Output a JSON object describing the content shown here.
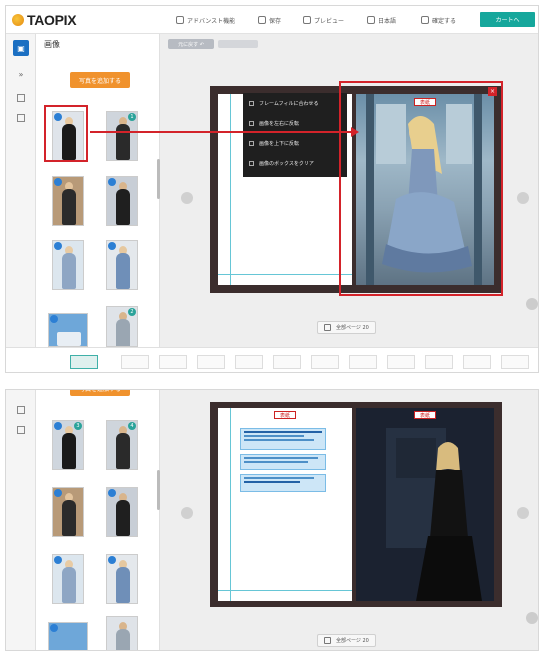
{
  "app": {
    "logo_text": "TAOPIX",
    "menu": [
      {
        "label": "アドバンスト機能",
        "icon": "edit-icon"
      },
      {
        "label": "保存",
        "icon": "save-icon"
      },
      {
        "label": "プレビュー",
        "icon": "preview-icon"
      },
      {
        "label": "日本語",
        "icon": "language-icon"
      },
      {
        "label": "確定する",
        "icon": "user-icon"
      }
    ],
    "order_button": "カートへ"
  },
  "sidebar": {
    "title": "画像",
    "upload_button": "写真を追加する",
    "thumb_badges": [
      "1",
      "2",
      "3",
      "4"
    ]
  },
  "toolbar": {
    "pill_label": "元に戻す ↶"
  },
  "context_menu": {
    "items": [
      {
        "label": "フレームフィルに合わせる",
        "icon": "fit-icon"
      },
      {
        "label": "画像を左右に反転",
        "icon": "flip-icon"
      },
      {
        "label": "画像を上下に反転",
        "icon": "flip-vertical-icon"
      },
      {
        "label": "画像のボックスをクリア",
        "icon": "clear-icon"
      }
    ]
  },
  "page": {
    "tag_label": "表紙",
    "indicator": "全部ページ 20"
  },
  "colors": {
    "accent": "#d3232a",
    "primary": "#1b6fc2",
    "order": "#16a79c",
    "upload": "#f0922d"
  }
}
